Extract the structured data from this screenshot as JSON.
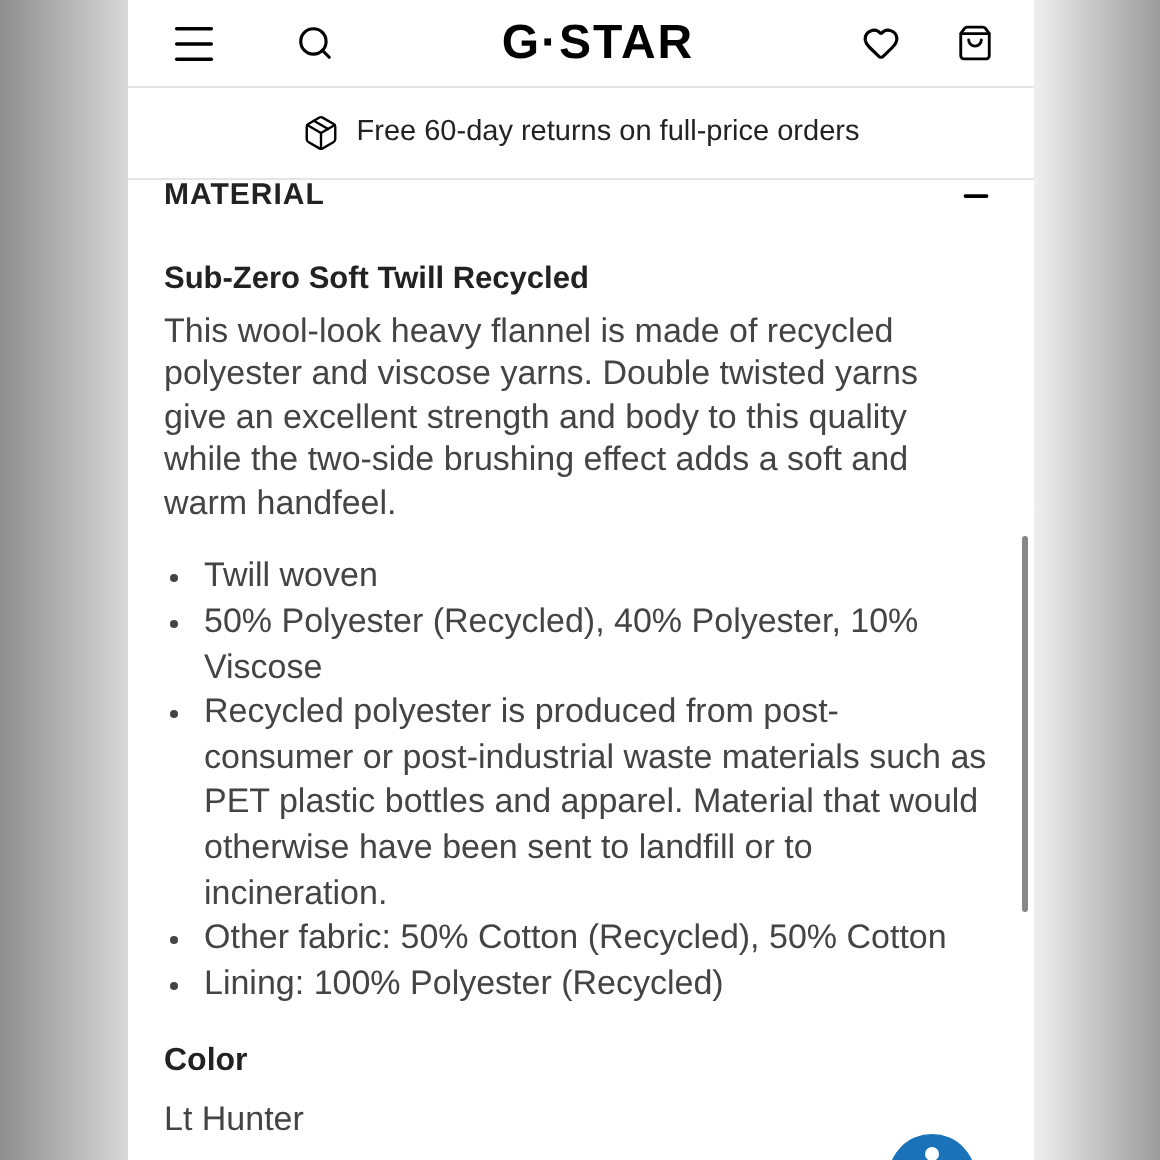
{
  "header": {
    "logo": "G·STAR"
  },
  "banner": {
    "text": "Free 60-day returns on full-price orders"
  },
  "section": {
    "heading": "MATERIAL",
    "expanded": true,
    "title": "Sub-Zero Soft Twill Recycled",
    "description": "This wool-look heavy flannel is made of recycled polyester and viscose yarns. Double twisted yarns give an excellent strength and body to this quality while the two-side brushing effect adds a soft and warm handfeel.",
    "bullets": [
      "Twill woven",
      "50% Polyester (Recycled), 40% Polyester, 10% Viscose",
      "Recycled polyester is produced from post-consumer or post-industrial waste materials such as PET plastic bottles and apparel. Material that would otherwise have been sent to landfill or to incineration.",
      "Other fabric: 50% Cotton (Recycled), 50% Cotton",
      "Lining: 100% Polyester (Recycled)"
    ],
    "color_label": "Color",
    "color_value": "Lt Hunter"
  }
}
